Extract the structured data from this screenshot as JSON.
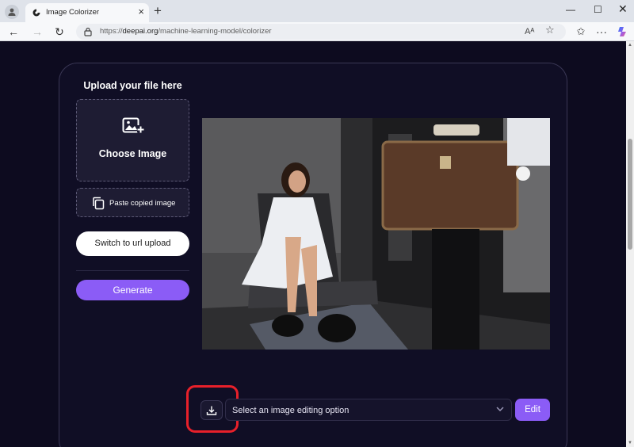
{
  "browser": {
    "tab_title": "Image Colorizer",
    "url_prefix": "https://",
    "url_host": "deepai.org",
    "url_path": "/machine-learning-model/colorizer",
    "new_tab": "+",
    "close_tab": "×"
  },
  "upload": {
    "title": "Upload your file here",
    "choose_label": "Choose Image",
    "paste_label": "Paste copied image",
    "switch_label": "Switch to url upload",
    "generate_label": "Generate"
  },
  "editor": {
    "select_placeholder": "Select an image editing option",
    "edit_label": "Edit"
  },
  "colors": {
    "page_bg": "#0d0b1f",
    "accent": "#8b5cf6",
    "highlight": "#e8202a"
  },
  "icons": [
    "account-icon",
    "tab-favicon-icon",
    "back-icon",
    "forward-icon",
    "reload-icon",
    "lock-icon",
    "read-aloud-icon",
    "favorite-icon",
    "favorites-bar-icon",
    "more-icon",
    "copilot-icon",
    "add-image-icon",
    "copy-icon",
    "download-icon",
    "chevron-down-icon"
  ]
}
